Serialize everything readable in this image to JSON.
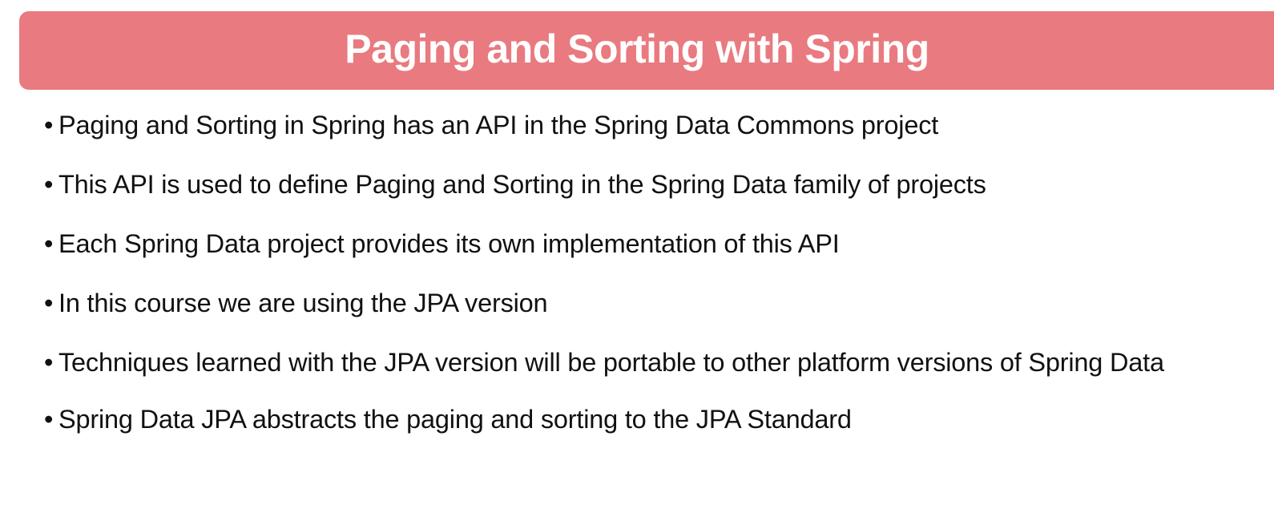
{
  "slide": {
    "title": "Paging and Sorting with Spring",
    "accent_color": "#e97a7f",
    "bullet_symbol": "•",
    "bullets": [
      "Paging and Sorting in Spring has an API in the Spring Data Commons project",
      "This API is used to define Paging and Sorting in the Spring Data family of projects",
      "Each Spring Data project provides its own implementation of this API",
      "In this course we are using the JPA version",
      "Techniques learned with the JPA version will be portable to other platform versions of Spring Data",
      "Spring Data JPA abstracts the paging and sorting to the JPA Standard"
    ]
  }
}
